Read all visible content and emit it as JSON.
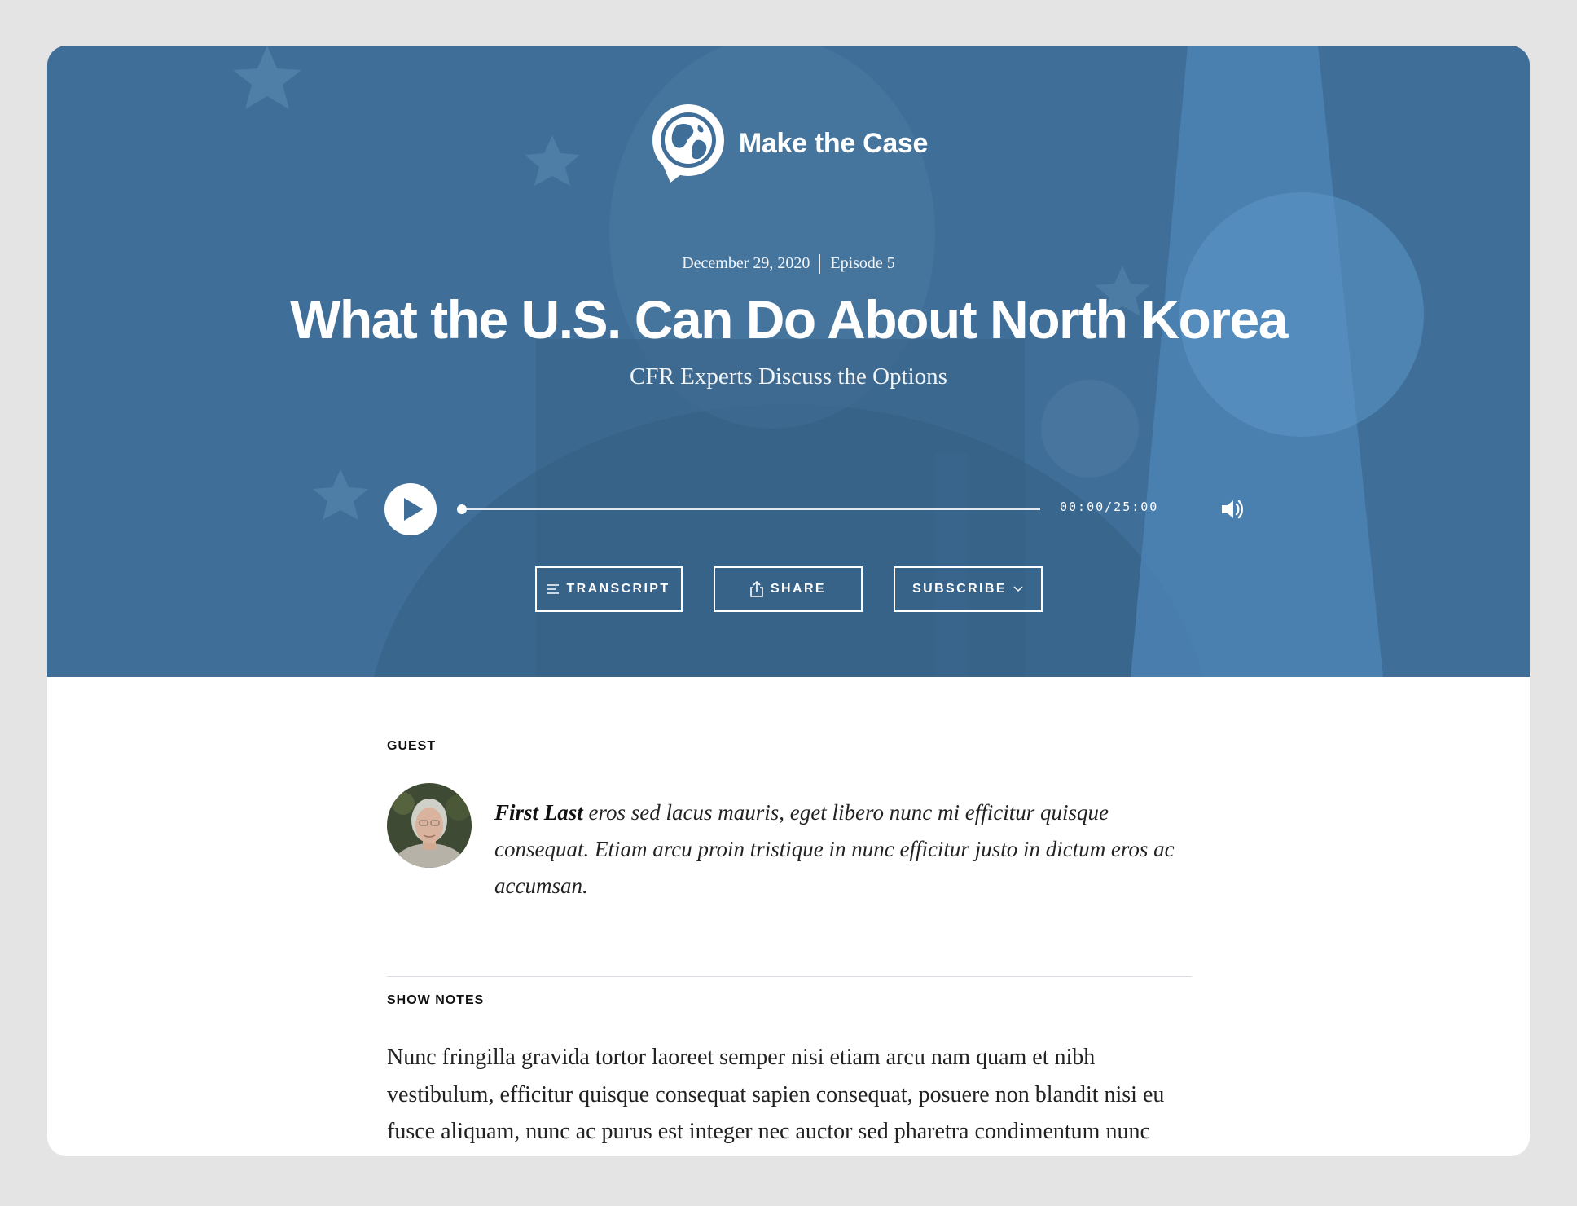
{
  "brand": {
    "name": "Make the Case",
    "logo_icon": "globe-speech-bubble-icon"
  },
  "episode": {
    "date": "December 29, 2020",
    "number": "Episode 5",
    "title": "What the U.S. Can Do About North Korea",
    "subtitle": "CFR Experts Discuss the Options"
  },
  "player": {
    "time": "00:00/25:00",
    "progress": 0,
    "play_icon": "play-icon",
    "volume_icon": "volume-icon"
  },
  "actions": {
    "transcript_label": "TRANSCRIPT",
    "share_label": "SHARE",
    "subscribe_label": "SUBSCRIBE"
  },
  "guest": {
    "section_label": "GUEST",
    "name": "First Last",
    "bio": " eros sed lacus mauris, eget libero nunc mi efficitur quisque consequat. Etiam arcu proin tristique in nunc efficitur justo in dictum eros ac accumsan."
  },
  "show_notes": {
    "section_label": "SHOW NOTES",
    "text": "Nunc fringilla gravida tortor laoreet semper nisi etiam arcu nam quam et nibh vestibulum, efficitur quisque consequat sapien consequat, posuere non blandit nisi eu fusce aliquam, nunc ac purus est integer nec auctor sed pharetra condimentum nunc quis lacus. Vestibulum tincidunt viverra lacus lectus elit in aliquam llaoreet lacus."
  },
  "colors": {
    "hero": "#3f6f98",
    "accent": "#ffffff",
    "text": "#222222"
  }
}
